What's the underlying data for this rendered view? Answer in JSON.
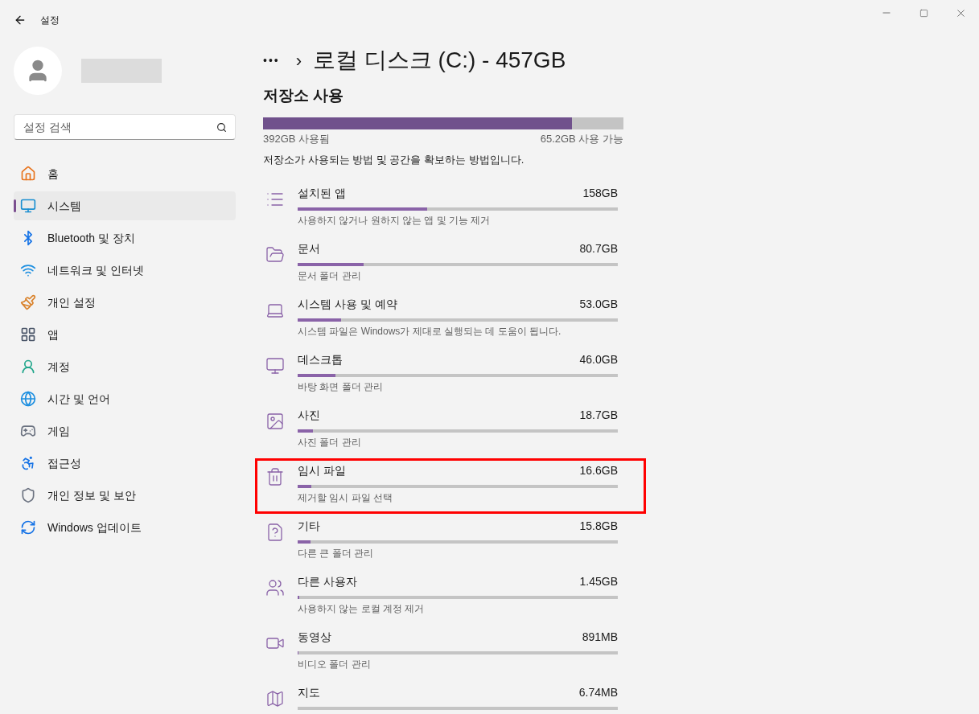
{
  "window": {
    "title": "설정"
  },
  "search": {
    "placeholder": "설정 검색"
  },
  "nav": [
    {
      "kind": "home",
      "label": "홈",
      "selected": false
    },
    {
      "kind": "system",
      "label": "시스템",
      "selected": true
    },
    {
      "kind": "bluetooth",
      "label": "Bluetooth 및 장치",
      "selected": false
    },
    {
      "kind": "network",
      "label": "네트워크 및 인터넷",
      "selected": false
    },
    {
      "kind": "personalize",
      "label": "개인 설정",
      "selected": false
    },
    {
      "kind": "apps",
      "label": "앱",
      "selected": false
    },
    {
      "kind": "accounts",
      "label": "계정",
      "selected": false
    },
    {
      "kind": "time",
      "label": "시간 및 언어",
      "selected": false
    },
    {
      "kind": "gaming",
      "label": "게임",
      "selected": false
    },
    {
      "kind": "accessibility",
      "label": "접근성",
      "selected": false
    },
    {
      "kind": "privacy",
      "label": "개인 정보 및 보안",
      "selected": false
    },
    {
      "kind": "update",
      "label": "Windows 업데이트",
      "selected": false
    }
  ],
  "breadcrumb": {
    "more": "•••",
    "separator": "›",
    "title": "로컬 디스크 (C:) - 457GB"
  },
  "usage": {
    "heading": "저장소 사용",
    "level": 0.857,
    "used": "392GB 사용됨",
    "free": "65.2GB 사용 가능",
    "description": "저장소가 사용되는 방법 및 공간을 확보하는 방법입니다."
  },
  "categories": [
    {
      "kind": "apps",
      "name": "설치된 앱",
      "size": "158GB",
      "level": 0.405,
      "hint": "사용하지 않거나 원하지 않는 앱 및 기능 제거",
      "highlighted": false
    },
    {
      "kind": "documents",
      "name": "문서",
      "size": "80.7GB",
      "level": 0.206,
      "hint": "문서 폴더 관리",
      "highlighted": false
    },
    {
      "kind": "system",
      "name": "시스템 사용 및 예약",
      "size": "53.0GB",
      "level": 0.136,
      "hint": "시스템 파일은 Windows가 제대로 실행되는 데 도움이 됩니다.",
      "highlighted": false
    },
    {
      "kind": "desktop",
      "name": "데스크톱",
      "size": "46.0GB",
      "level": 0.117,
      "hint": "바탕 화면 폴더 관리",
      "highlighted": false
    },
    {
      "kind": "pictures",
      "name": "사진",
      "size": "18.7GB",
      "level": 0.048,
      "hint": "사진 폴더 관리",
      "highlighted": false
    },
    {
      "kind": "temp",
      "name": "임시 파일",
      "size": "16.6GB",
      "level": 0.043,
      "hint": "제거할 임시 파일 선택",
      "highlighted": true
    },
    {
      "kind": "other",
      "name": "기타",
      "size": "15.8GB",
      "level": 0.04,
      "hint": "다른 큰 폴더 관리",
      "highlighted": false
    },
    {
      "kind": "users",
      "name": "다른 사용자",
      "size": "1.45GB",
      "level": 0.004,
      "hint": "사용하지 않는 로컬 계정 제거",
      "highlighted": false
    },
    {
      "kind": "videos",
      "name": "동영상",
      "size": "891MB",
      "level": 0.002,
      "hint": "비디오 폴더 관리",
      "highlighted": false
    },
    {
      "kind": "maps",
      "name": "지도",
      "size": "6.74MB",
      "highlighted": false
    }
  ]
}
